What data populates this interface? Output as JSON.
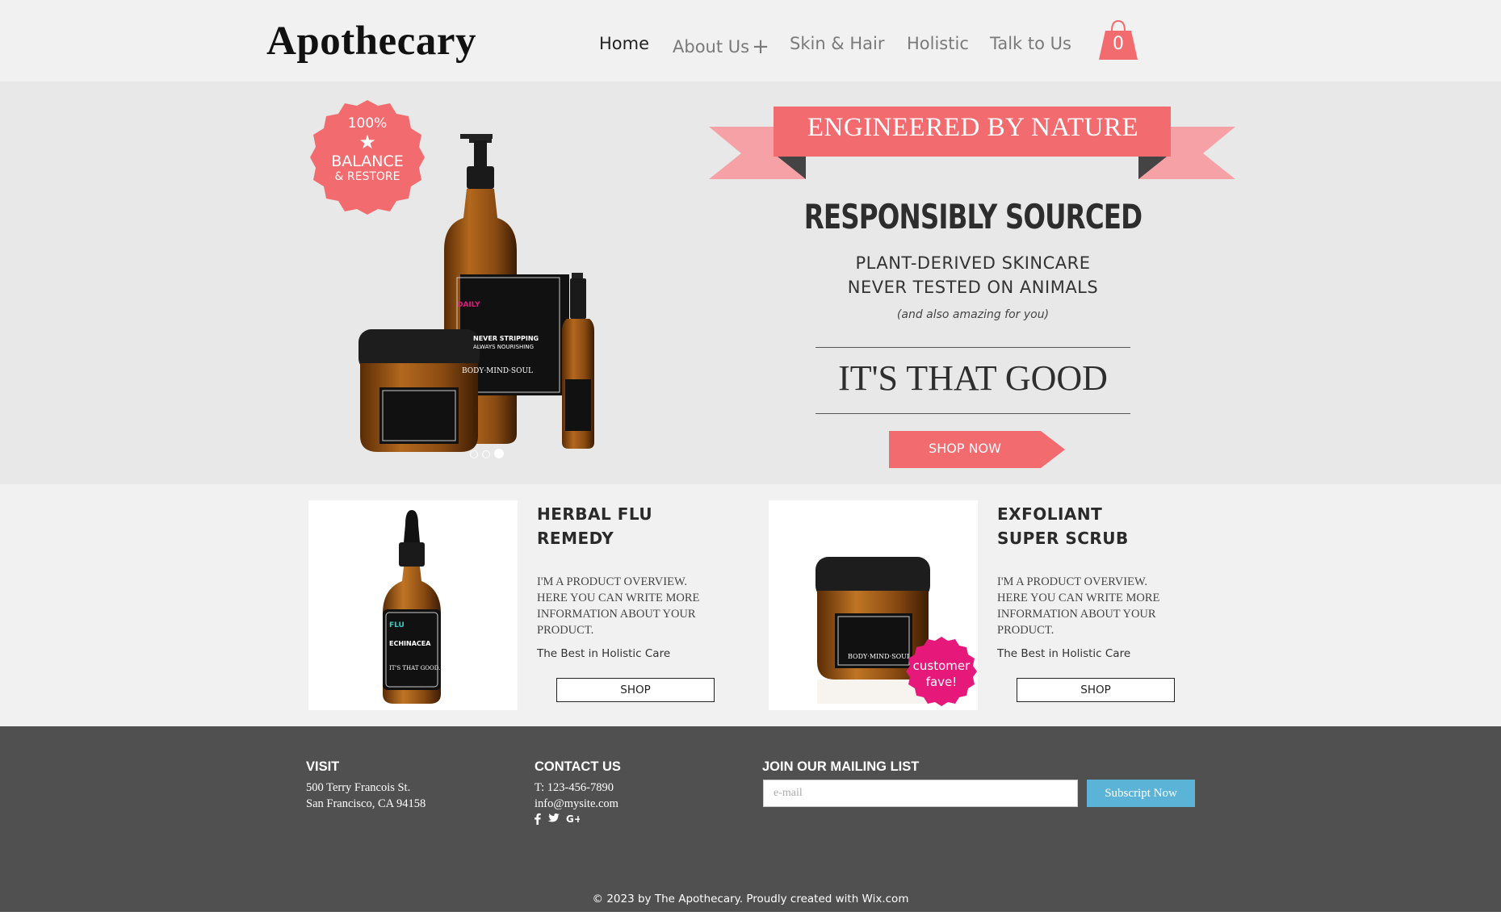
{
  "header": {
    "logo": "Apothecary",
    "nav": {
      "home": "Home",
      "about": "About Us",
      "about_expand": "+",
      "skin_hair": "Skin & Hair",
      "holistic": "Holistic",
      "talk": "Talk to Us"
    },
    "cart_count": "0"
  },
  "hero": {
    "badge": {
      "percent": "100%",
      "star": "★",
      "balance": "BALANCE",
      "restore": "& RESTORE"
    },
    "product_label_lines": [
      "DAILY",
      "NEVER STRIPPING",
      "ALWAYS NOURISHING",
      "BODY·MIND·SOUL"
    ],
    "ribbon": "ENGINEERED BY NATURE",
    "headline": "RESPONSIBLY SOURCED",
    "line1": "PLANT-DERIVED SKINCARE",
    "line2": "NEVER TESTED ON ANIMALS",
    "note": "(and also amazing for you)",
    "tagline": "IT'S THAT GOOD",
    "cta": "SHOP NOW",
    "slide_count": 3,
    "active_slide": 3
  },
  "products": [
    {
      "title_l1": "HERBAL FLU",
      "title_l2": "REMEDY",
      "desc": "I'M A PRODUCT OVERVIEW. HERE YOU CAN WRITE MORE INFORMATION ABOUT YOUR PRODUCT.",
      "tag": "The Best in Holistic Care",
      "button": "SHOP",
      "label_lines": [
        "FLU",
        "ECHINACEA",
        "IT'S THAT GOOD."
      ]
    },
    {
      "title_l1": "EXFOLIANT",
      "title_l2": "SUPER SCRUB",
      "desc": "I'M A PRODUCT OVERVIEW. HERE YOU CAN WRITE MORE INFORMATION ABOUT YOUR PRODUCT.",
      "tag": "The Best in Holistic Care",
      "button": "SHOP",
      "badge_l1": "customer",
      "badge_l2": "fave!",
      "label_lines": [
        "BODY·MIND·SOUL"
      ]
    }
  ],
  "footer": {
    "visit": {
      "heading": "VISIT",
      "line1": "500 Terry Francois St.",
      "line2": "San Francisco, CA 94158"
    },
    "contact": {
      "heading": "CONTACT US",
      "phone": "T: 123-456-7890",
      "email": "info@mysite.com",
      "social": [
        "facebook-icon",
        "twitter-icon",
        "google-plus-icon"
      ]
    },
    "mailing": {
      "heading": "JOIN OUR MAILING LIST",
      "placeholder": "e-mail",
      "button": "Subscript Now"
    },
    "copyright": "© 2023 by The Apothecary. Proudly created with Wix.com"
  },
  "colors": {
    "accent": "#f26b6e",
    "ribbon_tail": "#f6a1a6",
    "fave_badge": "#e6197a",
    "subscribe": "#5bb4d8",
    "footer_bg": "#505050",
    "amber": "#8a4b12"
  }
}
